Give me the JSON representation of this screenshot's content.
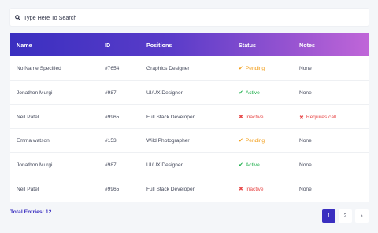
{
  "search": {
    "placeholder": "Type Here To Search"
  },
  "table": {
    "headers": {
      "name": "Name",
      "id": "ID",
      "positions": "Positions",
      "status": "Status",
      "notes": "Notes"
    },
    "rows": [
      {
        "name": "No Name Specified",
        "id": "#7654",
        "position": "Graphics Designer",
        "status": "Pending",
        "notes": "None"
      },
      {
        "name": "Jonathon Murgi",
        "id": "#987",
        "position": "UI/UX Designer",
        "status": "Active",
        "notes": "None"
      },
      {
        "name": "Neil Patel",
        "id": "#9965",
        "position": "Full Stack Developer",
        "status": "Inactive",
        "notes": "Requires call"
      },
      {
        "name": "Emma watson",
        "id": "#153",
        "position": "Wild Photographer",
        "status": "Pending",
        "notes": "None"
      },
      {
        "name": "Jonathon Murgi",
        "id": "#987",
        "position": "UI/UX Designer",
        "status": "Active",
        "notes": "None"
      },
      {
        "name": "Neil Patel",
        "id": "#9965",
        "position": "Full Stack Developer",
        "status": "Inactive",
        "notes": "None"
      }
    ]
  },
  "footer": {
    "total_entries": "Total Entries: 12",
    "pages": [
      "1",
      "2"
    ],
    "next": "›",
    "current_page": "1"
  },
  "colors": {
    "header_gradient_start": "#3a2fc0",
    "header_gradient_end": "#c066d8",
    "pending": "#f29b13",
    "active": "#1cae4a",
    "inactive": "#e84a4a"
  },
  "icons": {
    "search": "search-icon",
    "pending": "check-icon",
    "active": "check-icon",
    "inactive": "x-icon",
    "requires_call": "x-icon"
  }
}
